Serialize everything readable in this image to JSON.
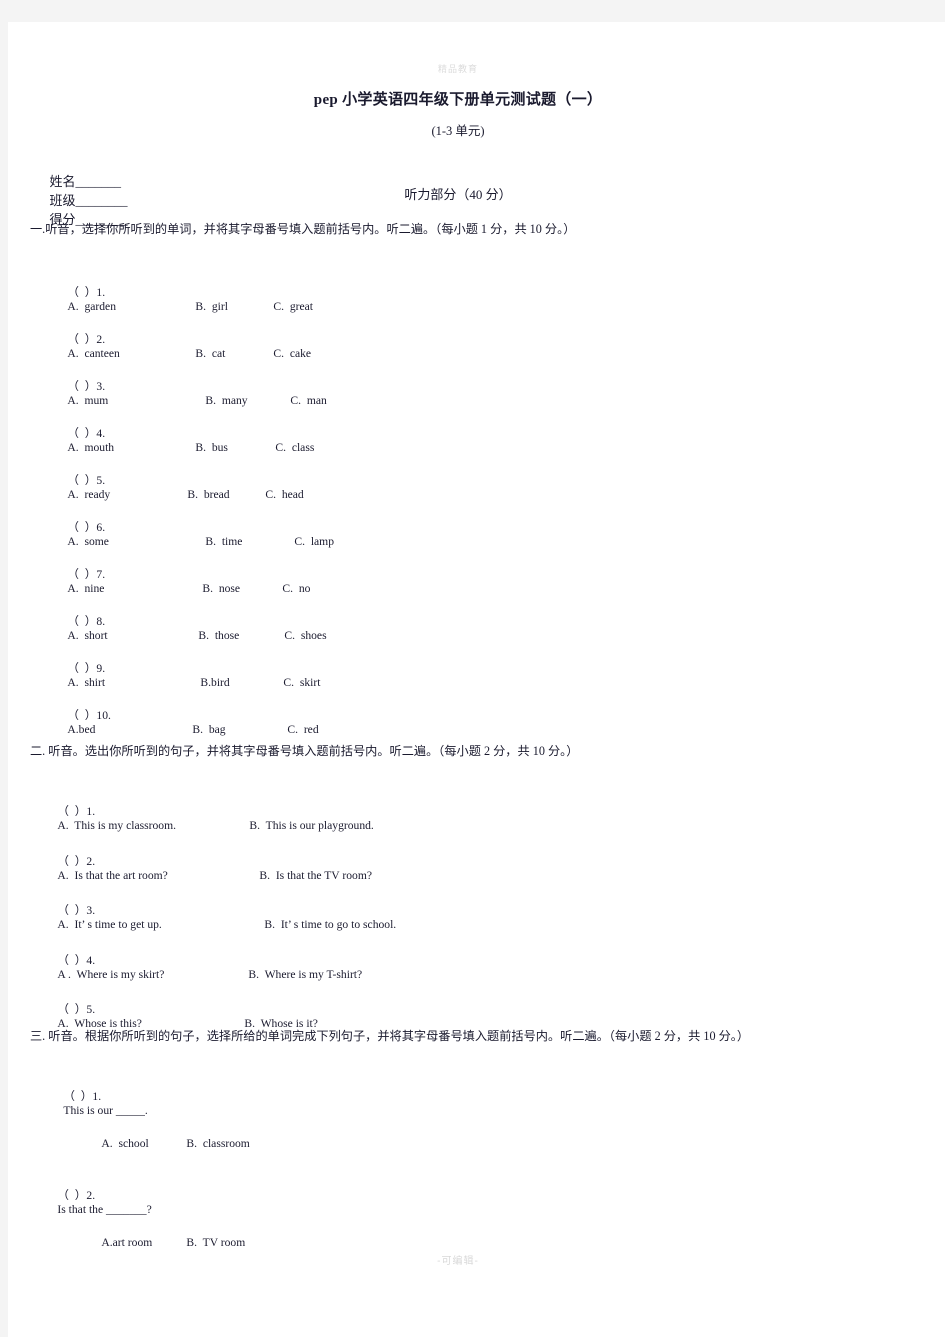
{
  "watermarks": {
    "top": "精品教育",
    "bottom": "-可编辑-"
  },
  "header": {
    "title": "pep 小学英语四年级下册单元测试题（一）",
    "subtitle": "(1-3 单元)",
    "meta": {
      "name_label": "姓名_______",
      "class_label": "班级________",
      "score_label": "得分________"
    },
    "section_banner": "听力部分（40 分）"
  },
  "sections": [
    {
      "instruction": "一.听音，选择你所听到的单词，并将其字母番号填入题前括号内。听二遍。（每小题 1 分，共 10 分。）",
      "items": [
        {
          "bracket": "（  ）",
          "number": "1.",
          "options": [
            "A.  garden",
            "B.  girl",
            "C.  great"
          ]
        },
        {
          "bracket": "（  ）",
          "number": "2.",
          "options": [
            "A.  canteen",
            "B.  cat",
            "C.  cake"
          ]
        },
        {
          "bracket": "（  ）",
          "number": "3.",
          "options": [
            "A.  mum",
            "B.  many",
            "C.  man"
          ]
        },
        {
          "bracket": "（  ）",
          "number": "4.",
          "options": [
            "A.  mouth",
            "B.  bus",
            "C.  class"
          ]
        },
        {
          "bracket": "（  ）",
          "number": "5.",
          "options": [
            "A.  ready",
            "B.  bread",
            "C.  head"
          ]
        },
        {
          "bracket": "（  ）",
          "number": "6.",
          "options": [
            "A.  some",
            "B.  time",
            "C.  lamp"
          ]
        },
        {
          "bracket": "（  ）",
          "number": "7.",
          "options": [
            "A.  nine",
            "B.  nose",
            "C.  no"
          ]
        },
        {
          "bracket": "（  ）",
          "number": "8.",
          "options": [
            "A.  short",
            "B.  those",
            "C.  shoes"
          ]
        },
        {
          "bracket": "（  ）",
          "number": "9.",
          "options": [
            "A.  shirt",
            "B.bird",
            "C.  skirt"
          ]
        },
        {
          "bracket": "（  ）",
          "number": "10.",
          "options": [
            "A.bed",
            "B.  bag",
            "C.  red"
          ]
        }
      ]
    },
    {
      "instruction": "二. 听音。选出你所听到的句子，并将其字母番号填入题前括号内。听二遍。（每小题 2 分，共 10 分。）",
      "items": [
        {
          "bracket": "（  ）",
          "number": "1.",
          "options": [
            "A.  This is my classroom.",
            "B.  This is our playground."
          ]
        },
        {
          "bracket": "（  ）",
          "number": "2.",
          "options": [
            "A.  Is that the art room?",
            "B.  Is that the TV room?"
          ]
        },
        {
          "bracket": "（  ）",
          "number": "3.",
          "options": [
            "A.  It’ s time to get up.",
            "B.  It’ s time to go to school."
          ]
        },
        {
          "bracket": "（  ）",
          "number": "4.",
          "options": [
            "A .  Where is my skirt?",
            "B.  Where is my T-shirt?"
          ]
        },
        {
          "bracket": "（  ）",
          "number": "5.",
          "options": [
            "A.  Whose is this?",
            "B.  Whose is it?"
          ]
        }
      ]
    },
    {
      "instruction": "三. 听音。根据你所听到的句子，选择所给的单词完成下列句子，并将其字母番号填入题前括号内。听二遍。（每小题 2 分，共 10 分。）",
      "items": [
        {
          "bracket": "（  ）",
          "number": "1.",
          "stem": "This is our _____.",
          "sub_options": [
            "A.  school",
            "B.  classroom"
          ]
        },
        {
          "bracket": "（  ）",
          "number": "2.",
          "stem": "Is that the _______?",
          "sub_options": [
            "A.art room",
            "B.  TV room"
          ]
        }
      ]
    }
  ]
}
